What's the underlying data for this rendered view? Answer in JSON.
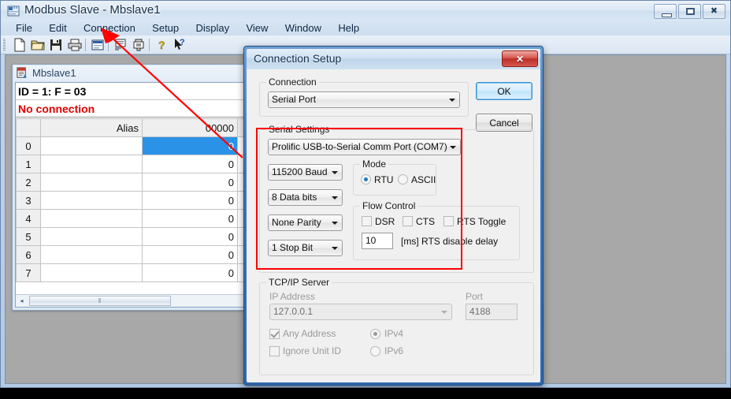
{
  "app": {
    "title": "Modbus Slave - Mbslave1",
    "title_icon": "modbus-app-icon",
    "window_buttons": {
      "minimize": "minimize-icon",
      "maximize": "maximize-icon",
      "close": "close-icon"
    },
    "menu": [
      "File",
      "Edit",
      "Connection",
      "Setup",
      "Display",
      "View",
      "Window",
      "Help"
    ],
    "toolbar": [
      "new-document-icon",
      "open-folder-icon",
      "save-disk-icon",
      "print-icon",
      "separator",
      "display-window-icon",
      "separator",
      "list-icon",
      "device-icon",
      "separator",
      "help-question-icon",
      "context-help-icon"
    ]
  },
  "mdi": {
    "title": "Mbslave1",
    "icon": "document-icon",
    "id_line": "ID = 1: F = 03",
    "status_line": "No connection",
    "status_color": "#e00000",
    "columns": [
      "",
      "Alias",
      "00000",
      ""
    ],
    "rows": [
      {
        "index": "0",
        "alias": "",
        "value": "0",
        "selected": true
      },
      {
        "index": "1",
        "alias": "",
        "value": "0",
        "selected": false
      },
      {
        "index": "2",
        "alias": "",
        "value": "0",
        "selected": false
      },
      {
        "index": "3",
        "alias": "",
        "value": "0",
        "selected": false
      },
      {
        "index": "4",
        "alias": "",
        "value": "0",
        "selected": false
      },
      {
        "index": "5",
        "alias": "",
        "value": "0",
        "selected": false
      },
      {
        "index": "6",
        "alias": "",
        "value": "0",
        "selected": false
      },
      {
        "index": "7",
        "alias": "",
        "value": "0",
        "selected": false
      }
    ],
    "scroll_left_arrow": "◂",
    "scroll_thumb_grip": "‖"
  },
  "dialog": {
    "title": "Connection Setup",
    "close_label": "✕",
    "ok_label": "OK",
    "cancel_label": "Cancel",
    "connection": {
      "legend": "Connection",
      "value": "Serial Port"
    },
    "serial": {
      "legend": "Serial Settings",
      "port": "Prolific USB-to-Serial Comm Port (COM7)",
      "baud": "115200 Baud",
      "data_bits": "8 Data bits",
      "parity": "None Parity",
      "stop_bits": "1 Stop Bit",
      "mode": {
        "legend": "Mode",
        "rtu": "RTU",
        "ascii": "ASCII",
        "selected": "RTU"
      },
      "flow_control": {
        "legend": "Flow Control",
        "dsr": "DSR",
        "cts": "CTS",
        "rts_toggle": "RTS Toggle",
        "rts_delay_value": "10",
        "rts_delay_label": "[ms] RTS disable delay"
      }
    },
    "tcpip": {
      "legend": "TCP/IP Server",
      "ip_label": "IP Address",
      "ip_value": "127.0.0.1",
      "port_label": "Port",
      "port_value": "4188",
      "any_address": "Any Address",
      "ignore_unit_id": "Ignore Unit ID",
      "ipv4": "IPv4",
      "ipv6": "IPv6"
    }
  },
  "annotation": {
    "highlight_color": "#ff0000",
    "arrow_from": "308,200",
    "arrow_to": "132,41",
    "rect_target": "Serial Settings"
  }
}
